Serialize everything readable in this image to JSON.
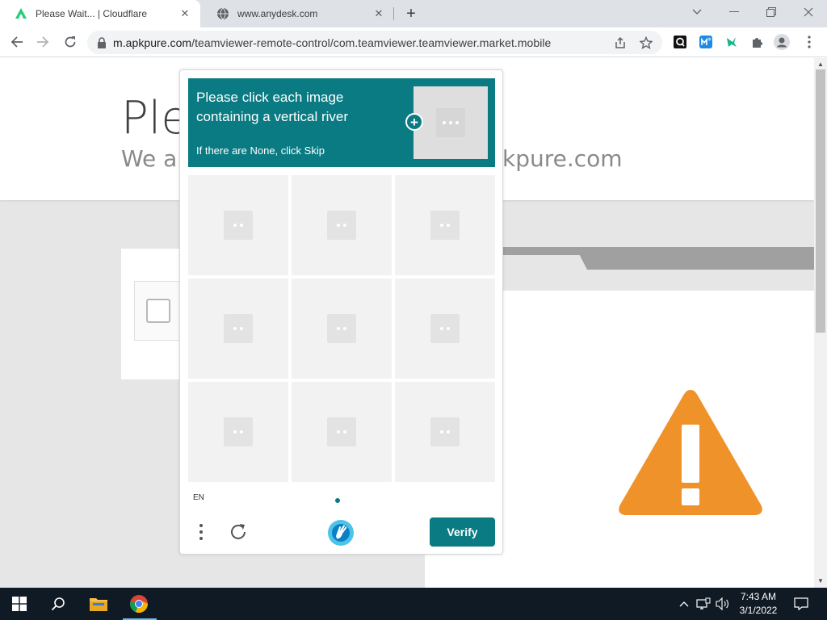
{
  "browser": {
    "tabs": [
      {
        "title": "Please Wait... | Cloudflare",
        "active": true,
        "favicon": "apkpure-logo-icon"
      },
      {
        "title": "www.anydesk.com",
        "active": false,
        "favicon": "globe-icon"
      }
    ],
    "url_host": "m.apkpure.com",
    "url_path": "/teamviewer-remote-control/com.teamviewer.teamviewer.market.mobile"
  },
  "page": {
    "title_partial": "Ple",
    "subtitle_partial_left": "We ar",
    "subtitle_partial_right": "kpure.com"
  },
  "captcha": {
    "prompt": "Please click each image containing a vertical river",
    "hint": "If there are None, click Skip",
    "language": "EN",
    "verify_label": "Verify",
    "accent_color": "#0a7b83"
  },
  "taskbar": {
    "time": "7:43 AM",
    "date": "3/1/2022"
  },
  "colors": {
    "warning": "#f0922a",
    "taskbar": "#101a24"
  }
}
